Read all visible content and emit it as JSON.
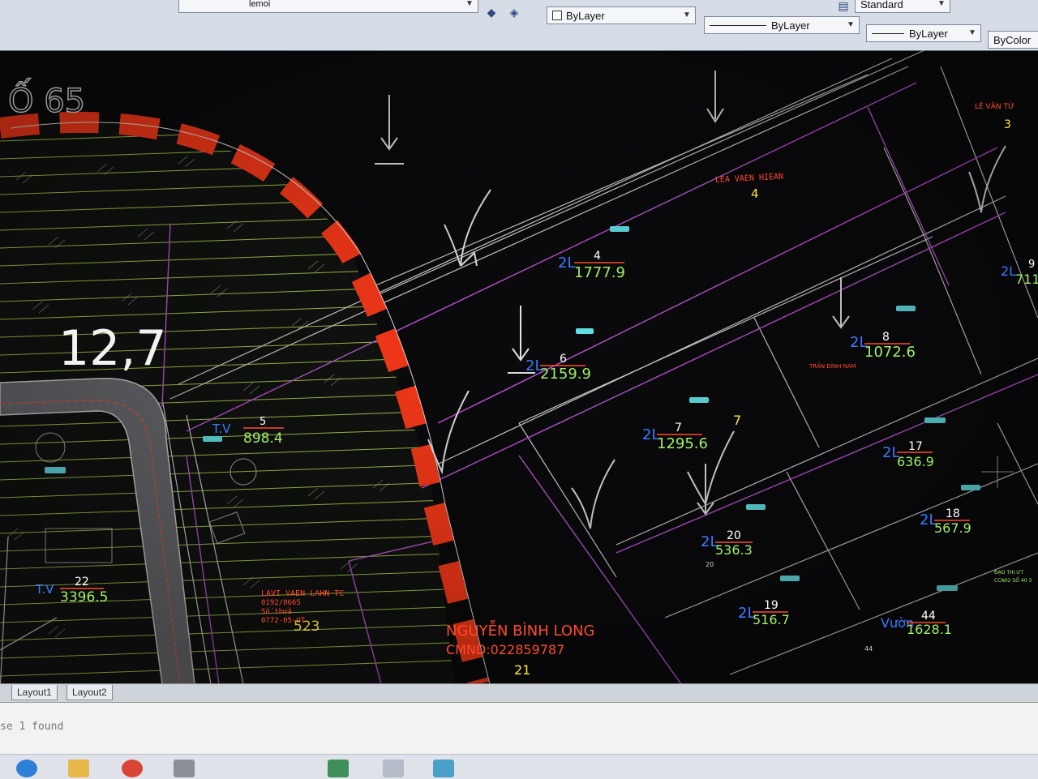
{
  "toolbar": {
    "layer_name": "lemoi",
    "color_value": "ByLayer",
    "linetype_value": "ByLayer",
    "lineweight_value": "ByLayer",
    "plotstyle_value": "ByColor",
    "textstyle_value": "Standard"
  },
  "drawing": {
    "corner_label": "Ố 65",
    "dimension_label": "12,7",
    "owner_label_top": "LEA VAEN HIEAN",
    "owner_number_top": "4",
    "parcels": [
      {
        "prefix": "2L",
        "number": "4",
        "area": "1777.9"
      },
      {
        "prefix": "2L",
        "number": "6",
        "area": "2159.9"
      },
      {
        "prefix": "2L",
        "number": "7",
        "area": "1295.6"
      },
      {
        "prefix": "2L",
        "number": "8",
        "area": "1072.6"
      },
      {
        "prefix": "2L",
        "number": "17",
        "area": "636.9"
      },
      {
        "prefix": "2L",
        "number": "18",
        "area": "567.9"
      },
      {
        "prefix": "2L",
        "number": "20",
        "area": "536.3"
      },
      {
        "prefix": "2L",
        "number": "19",
        "area": "516.7"
      },
      {
        "prefix": "Vườn",
        "number": "44",
        "area": "1628.1"
      },
      {
        "prefix": "T.V",
        "number": "5",
        "area": "898.4"
      },
      {
        "prefix": "T.V",
        "number": "22",
        "area": "3396.5"
      },
      {
        "prefix": "2L",
        "number": "9",
        "area": "711"
      }
    ],
    "yellow_label_7": "7",
    "owner_small_1": "TRẦN ĐÌNH NAM",
    "owner_bottom_name": "NGUYỄN BÌNH LONG",
    "owner_bottom_id": "CMND:022859787",
    "owner_bottom_number": "21",
    "owner_left_text": [
      "LAVI VAEN LAHN-TC",
      "0192/0665",
      "Số thửa",
      "0772-05-UT"
    ],
    "owner_left_number": "523",
    "right_small_text": [
      "ĐẠO THỊ ƯT",
      "CCN02 SỐ 40 3"
    ],
    "right_top_text": "LÊ VĂN TỪ",
    "right_top_number": "3",
    "small_number_44": "44",
    "small_number_20": "20"
  },
  "layout_tabs": [
    "Layout1",
    "Layout2"
  ],
  "command_line": {
    "text": "se 1 found"
  },
  "colors": {
    "background": "#0b0b0d",
    "parcel_line": "#d4d4d4",
    "road_fill": "#6d6d72",
    "hatch": "#c8e85a",
    "boundary_magenta": "#c05ad8",
    "dash_red": "#ff3b1a",
    "label_blue": "#3a7bff",
    "label_green": "#9ff06a",
    "label_red": "#ff4a2a",
    "symbol_cyan": "#66e6ea",
    "label_yellow": "#ffe640"
  }
}
